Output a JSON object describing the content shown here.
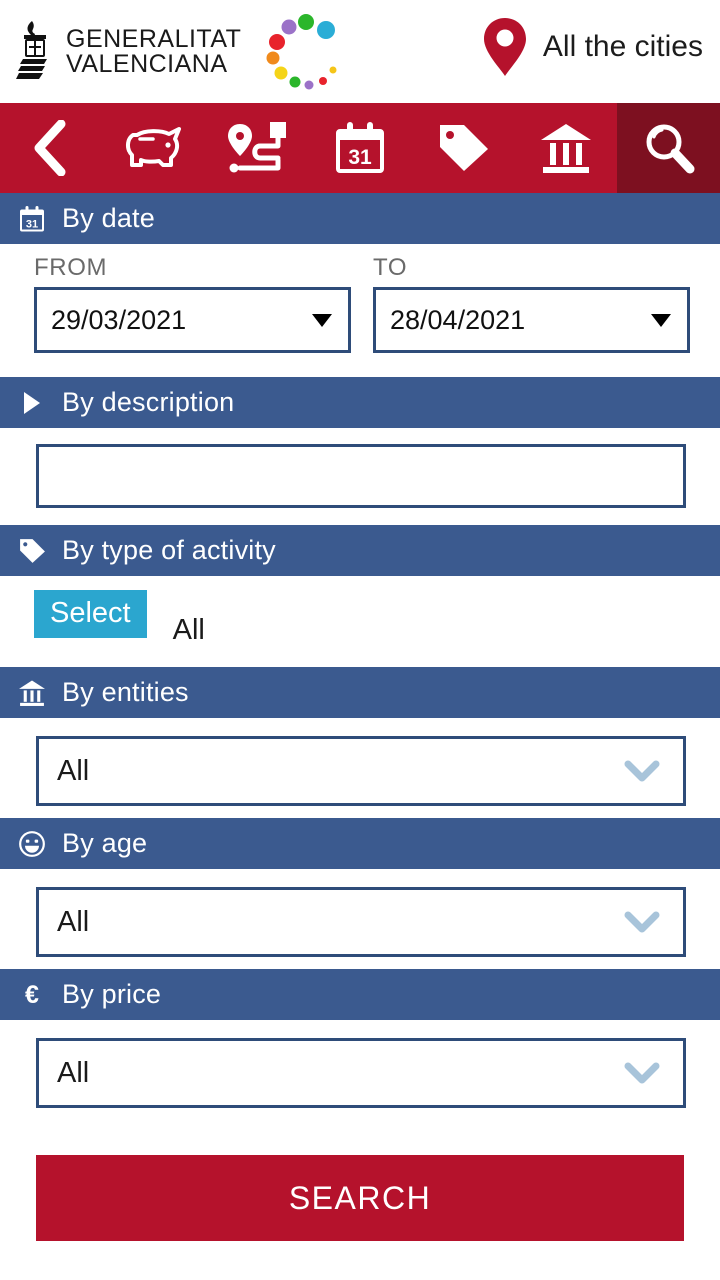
{
  "brand": {
    "org_line1": "GENERALITAT",
    "org_line2": "VALENCIANA",
    "shield_icon": "valencia-coat-of-arms",
    "dots_icon": "culturarts-dots-logo"
  },
  "header": {
    "location_icon": "map-pin-icon",
    "location_label": "All the cities"
  },
  "nav": {
    "items": [
      {
        "icon": "back-chevron-icon",
        "name": "back",
        "active": false
      },
      {
        "icon": "piggy-bank-icon",
        "name": "savings",
        "active": false
      },
      {
        "icon": "route-map-icon",
        "name": "routes",
        "active": false
      },
      {
        "icon": "calendar-31-icon",
        "name": "calendar",
        "active": false
      },
      {
        "icon": "tag-icon",
        "name": "activities",
        "active": false
      },
      {
        "icon": "museum-icon",
        "name": "entities",
        "active": false
      },
      {
        "icon": "search-icon",
        "name": "search",
        "active": true
      }
    ]
  },
  "sections": {
    "date": {
      "icon": "calendar-31-icon",
      "title": "By date",
      "from_label": "FROM",
      "from_value": "29/03/2021",
      "to_label": "TO",
      "to_value": "28/04/2021"
    },
    "description": {
      "icon": "triangle-right-icon",
      "title": "By description",
      "value": "",
      "placeholder": ""
    },
    "activity": {
      "icon": "tag-icon",
      "title": "By type of activity",
      "select_label": "Select",
      "value": "All"
    },
    "entities": {
      "icon": "museum-icon",
      "title": "By entities",
      "value": "All"
    },
    "age": {
      "icon": "smiley-icon",
      "title": "By age",
      "value": "All"
    },
    "price": {
      "icon": "euro-icon",
      "title": "By price",
      "value": "All"
    }
  },
  "footer": {
    "search_label": "SEARCH"
  },
  "colors": {
    "brand_red": "#b5122c",
    "brand_red_active": "#7d1020",
    "header_blue": "#3b5a8f",
    "border_blue": "#2e4c79",
    "select_cyan": "#2ba6cf",
    "chevron_blue": "#a8c4da"
  }
}
